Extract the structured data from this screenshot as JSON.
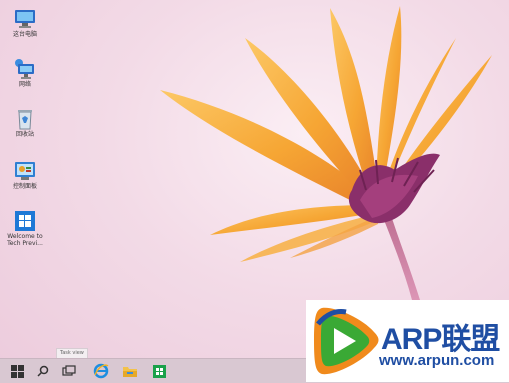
{
  "desktop": {
    "icons": [
      {
        "name": "this-pc",
        "label": "这台电脑"
      },
      {
        "name": "network",
        "label": "网络"
      },
      {
        "name": "recycle-bin",
        "label": "回收站"
      },
      {
        "name": "control-panel",
        "label": "控制面板"
      },
      {
        "name": "welcome",
        "label": "Welcome to Tech Previ..."
      }
    ]
  },
  "taskbar": {
    "tooltip": "Task view",
    "buttons": [
      "start-icon",
      "search-icon",
      "task-view-icon",
      "ie-icon",
      "file-explorer-icon",
      "store-icon"
    ]
  },
  "watermark": {
    "title": "ARP联盟",
    "url": "www.arpun.com",
    "colors": {
      "blue": "#1f4ea3",
      "green": "#3aa935",
      "orange": "#f08a1c"
    }
  }
}
